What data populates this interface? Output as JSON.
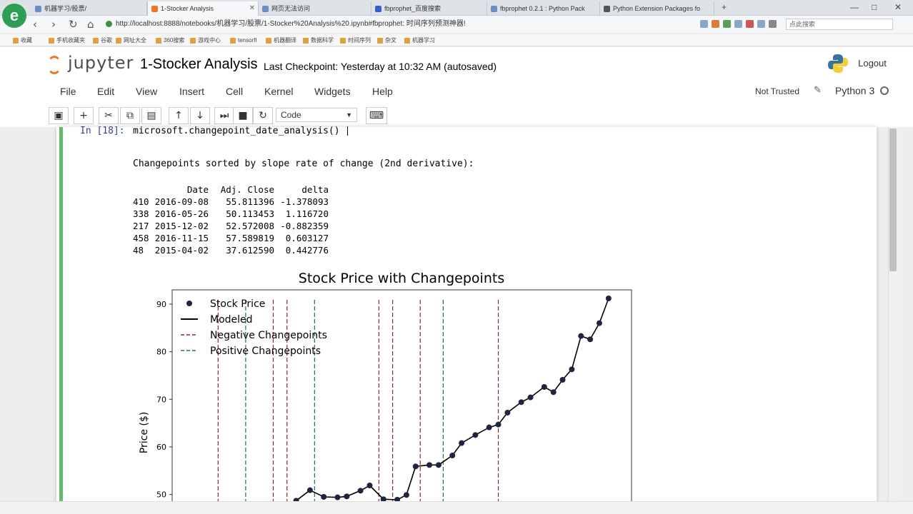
{
  "browser": {
    "tabs": [
      {
        "label": "机器学习/股票/"
      },
      {
        "label": "1-Stocker Analysis"
      },
      {
        "label": "网页无法访问"
      },
      {
        "label": "fbprophet_百度搜索"
      },
      {
        "label": "fbprophet 0.2.1 : Python Pack"
      },
      {
        "label": "Python Extension Packages fo"
      }
    ],
    "url": "http://localhost:8888/notebooks/机器学习/股票/1-Stocker%20Analysis%20.ipynb#fbprophet: 时间序列预测神器!",
    "search_placeholder": "点此搜索",
    "bookmarks": [
      "收藏",
      "手机收藏夹",
      "谷歌",
      "网址大全",
      "360搜索",
      "游戏中心",
      "tensorfl",
      "机器翻译",
      "数据科学",
      "时间序列",
      "杂文",
      "机器学习"
    ]
  },
  "jupyter": {
    "wordmark": "jupyter",
    "notebook_title": "1-Stocker Analysis",
    "checkpoint": "Last Checkpoint: Yesterday at 10:32 AM (autosaved)",
    "logout_label": "Logout",
    "menu": [
      "File",
      "Edit",
      "View",
      "Insert",
      "Cell",
      "Kernel",
      "Widgets",
      "Help"
    ],
    "trust_label": "Not Trusted",
    "kernel_name": "Python 3",
    "cell_type": "Code"
  },
  "cell": {
    "prompt": "In [18]:",
    "code": "microsoft.changepoint_date_analysis()",
    "output_header": "Changepoints sorted by slope rate of change (2nd derivative):",
    "table": {
      "columns": [
        "",
        "Date",
        "Adj. Close",
        "delta"
      ],
      "rows": [
        [
          "410",
          "2016-09-08",
          "55.811396",
          "-1.378093"
        ],
        [
          "338",
          "2016-05-26",
          "50.113453",
          "1.116720"
        ],
        [
          "217",
          "2015-12-02",
          "52.572008",
          "-0.882359"
        ],
        [
          "458",
          "2016-11-15",
          "57.589819",
          "0.603127"
        ],
        [
          "48",
          "2015-04-02",
          "37.612590",
          "0.442776"
        ]
      ]
    }
  },
  "chart_data": {
    "type": "line",
    "title": "Stock Price with Changepoints",
    "ylabel": "Price ($)",
    "xlabel": "",
    "ylim": [
      48,
      93
    ],
    "yticks": [
      50,
      60,
      70,
      80,
      90
    ],
    "legend": [
      "Stock Price",
      "Modeled",
      "Negative Changepoints",
      "Positive Changepoints"
    ],
    "legend_position": "top-left",
    "x_domain": [
      0,
      1
    ],
    "series": [
      {
        "name": "Stock Price",
        "x": [
          0.27,
          0.3,
          0.33,
          0.36,
          0.38,
          0.41,
          0.43,
          0.46,
          0.49,
          0.51,
          0.53,
          0.56,
          0.58,
          0.61,
          0.63,
          0.66,
          0.69,
          0.71,
          0.73,
          0.76,
          0.78,
          0.81,
          0.83,
          0.85,
          0.87,
          0.89,
          0.91,
          0.93,
          0.95
        ],
        "values": [
          48.7,
          50.9,
          49.5,
          49.4,
          49.6,
          50.8,
          51.9,
          49.0,
          48.9,
          49.9,
          55.9,
          56.2,
          56.2,
          58.2,
          60.8,
          62.5,
          64.1,
          64.7,
          67.2,
          69.4,
          70.4,
          72.6,
          71.5,
          74.1,
          76.3,
          83.3,
          82.6,
          86.0,
          91.2
        ]
      }
    ],
    "changepoints": [
      {
        "x": 0.1,
        "type": "negative"
      },
      {
        "x": 0.16,
        "type": "positive"
      },
      {
        "x": 0.22,
        "type": "negative"
      },
      {
        "x": 0.25,
        "type": "negative"
      },
      {
        "x": 0.31,
        "type": "positive"
      },
      {
        "x": 0.45,
        "type": "negative"
      },
      {
        "x": 0.48,
        "type": "negative"
      },
      {
        "x": 0.54,
        "type": "negative"
      },
      {
        "x": 0.59,
        "type": "positive"
      },
      {
        "x": 0.71,
        "type": "negative"
      }
    ],
    "colors": {
      "points": "#1f2540",
      "negative": "#8b2a2a",
      "positive": "#2a6a4a"
    }
  }
}
